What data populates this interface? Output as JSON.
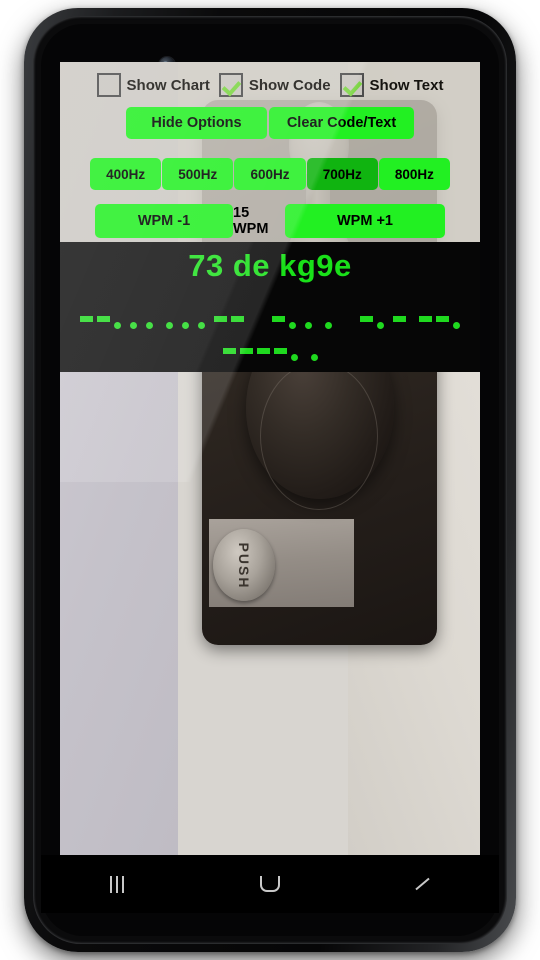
{
  "device": {
    "type": "android-phone",
    "camera_icon": "front-camera-icon",
    "speaker_icon": "earpiece-speaker-icon"
  },
  "options": {
    "checkboxes": [
      {
        "label": "Show Chart",
        "checked": false,
        "name": "show-chart"
      },
      {
        "label": "Show Code",
        "checked": true,
        "name": "show-code"
      },
      {
        "label": "Show Text",
        "checked": true,
        "name": "show-text"
      }
    ],
    "actions": {
      "hide_options_label": "Hide  Options",
      "clear_label": "Clear Code/Text"
    },
    "frequencies": {
      "options": [
        "400Hz",
        "500Hz",
        "600Hz",
        "700Hz",
        "800Hz"
      ],
      "selected": "700Hz"
    },
    "speed": {
      "decrease_label": "WPM -1",
      "value_label": "15 WPM",
      "value": 15,
      "increase_label": "WPM +1"
    }
  },
  "output": {
    "text": "73 de kg9e",
    "code_lines": [
      {
        "chars": [
          {
            "char": "7",
            "symbols": [
              "dash",
              "dash",
              "dot",
              "dot",
              "dot"
            ]
          },
          {
            "char": "3",
            "symbols": [
              "dot",
              "dot",
              "dot",
              "dash",
              "dash"
            ]
          },
          {
            "char": "space",
            "symbols": []
          },
          {
            "char": "d",
            "symbols": [
              "dash",
              "dot",
              "dot"
            ]
          },
          {
            "char": "e",
            "symbols": [
              "dot"
            ]
          },
          {
            "char": "space",
            "symbols": []
          },
          {
            "char": "k",
            "symbols": [
              "dash",
              "dot",
              "dash"
            ]
          },
          {
            "char": "g",
            "symbols": [
              "dash",
              "dash",
              "dot"
            ]
          }
        ]
      },
      {
        "chars": [
          {
            "char": "9",
            "symbols": [
              "dash",
              "dash",
              "dash",
              "dash",
              "dot"
            ]
          },
          {
            "char": "e",
            "symbols": [
              "dot"
            ]
          }
        ]
      }
    ]
  },
  "background": {
    "subject": "telegraph-key-photo",
    "push_button_label": "PUSH"
  },
  "nav_bar": {
    "recents_label": "recents-icon",
    "home_label": "home-icon",
    "back_label": "back-icon"
  },
  "colors": {
    "button_green": "#22f022",
    "button_green_selected": "#10b410",
    "code_green": "#1fd91f",
    "text_green": "#19e019",
    "panel_bg": "#cdc9c1",
    "output_bg": "#060606"
  }
}
